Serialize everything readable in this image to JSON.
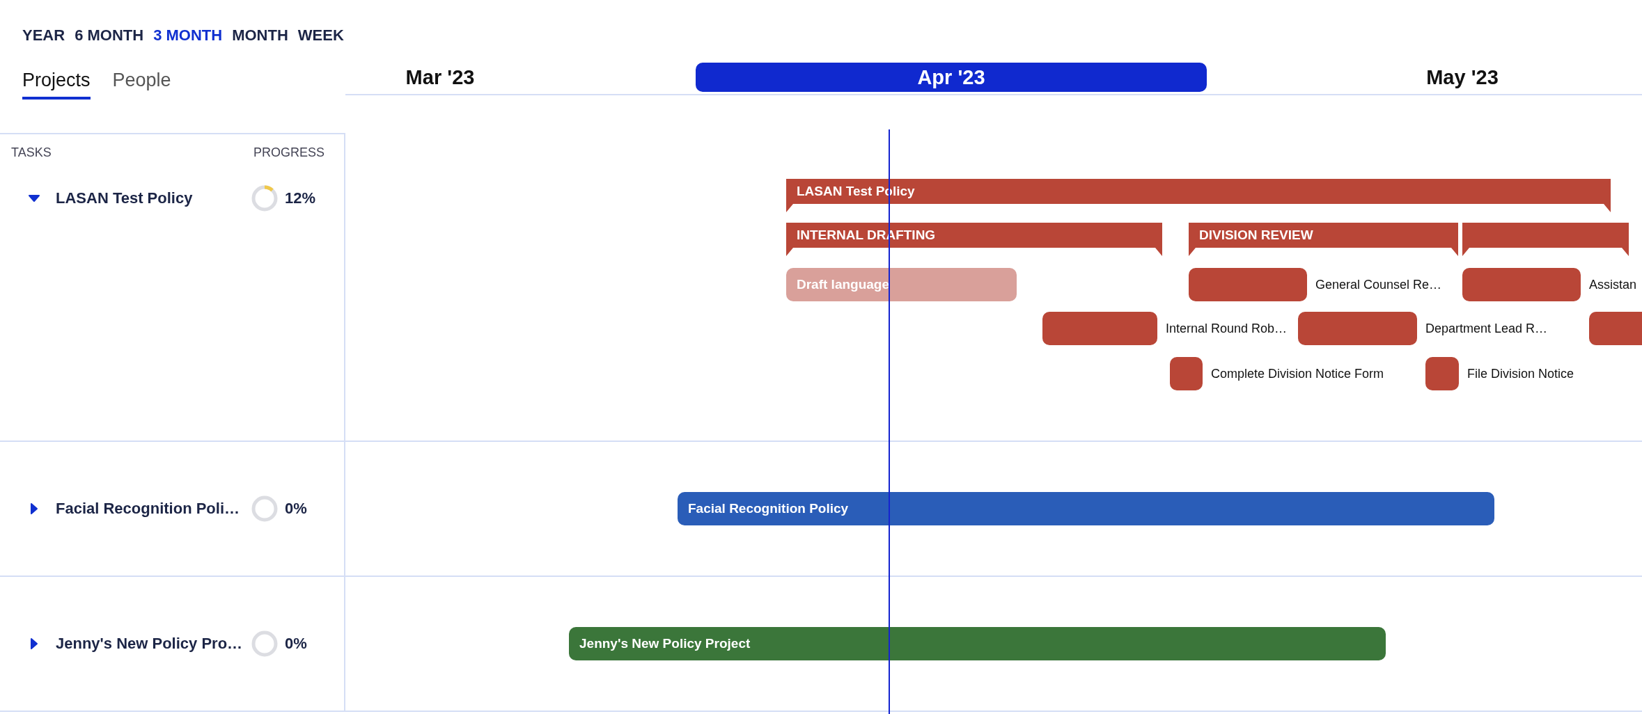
{
  "timescale": [
    {
      "label": "YEAR",
      "selected": false
    },
    {
      "label": "6 MONTH",
      "selected": false
    },
    {
      "label": "3 MONTH",
      "selected": true
    },
    {
      "label": "MONTH",
      "selected": false
    },
    {
      "label": "WEEK",
      "selected": false
    }
  ],
  "tabs": [
    {
      "label": "Projects",
      "selected": true
    },
    {
      "label": "People",
      "selected": false
    }
  ],
  "months": [
    {
      "label": "Mar '23",
      "selected": false
    },
    {
      "label": "Apr '23",
      "selected": true
    },
    {
      "label": "May '23",
      "selected": false
    }
  ],
  "columns": {
    "tasks": "TASKS",
    "progress": "PROGRESS"
  },
  "projects": [
    {
      "name": "LASAN Test Policy",
      "expanded": true,
      "progress": "12%",
      "level": 0.12,
      "color": "#b94637",
      "bar_label": "LASAN Test Policy",
      "phases": [
        {
          "kind": "labelled",
          "label": "INTERNAL DRAFTING"
        },
        {
          "kind": "labelled",
          "label": "DIVISION REVIEW"
        },
        {
          "kind": "blank"
        }
      ],
      "tasks": [
        {
          "label": "Draft language",
          "kind": "inside",
          "color": "#d9a09a"
        },
        {
          "label": "General Counsel Re…",
          "kind": "outside",
          "color": "#b94637"
        },
        {
          "label": "Assistan",
          "kind": "outside",
          "color": "#b94637"
        },
        {
          "label": "Internal Round Rob…",
          "kind": "outside",
          "color": "#b94637"
        },
        {
          "label": "Department Lead R…",
          "kind": "outside",
          "color": "#b94637"
        },
        {
          "kind": "outside",
          "color": "#b94637"
        },
        {
          "label": "Complete Division Notice Form",
          "kind": "outside",
          "color": "#b94637"
        },
        {
          "label": "File Division Notice",
          "kind": "outside",
          "color": "#b94637"
        }
      ]
    },
    {
      "name": "Facial Recognition Poli…",
      "expanded": false,
      "progress": "0%",
      "level": 0,
      "color": "#2a5db8",
      "bar_label": "Facial Recognition Policy"
    },
    {
      "name": "Jenny's New Policy Pro…",
      "expanded": false,
      "progress": "0%",
      "level": 0,
      "color": "#3b763a",
      "bar_label": "Jenny's New Policy Project"
    }
  ]
}
